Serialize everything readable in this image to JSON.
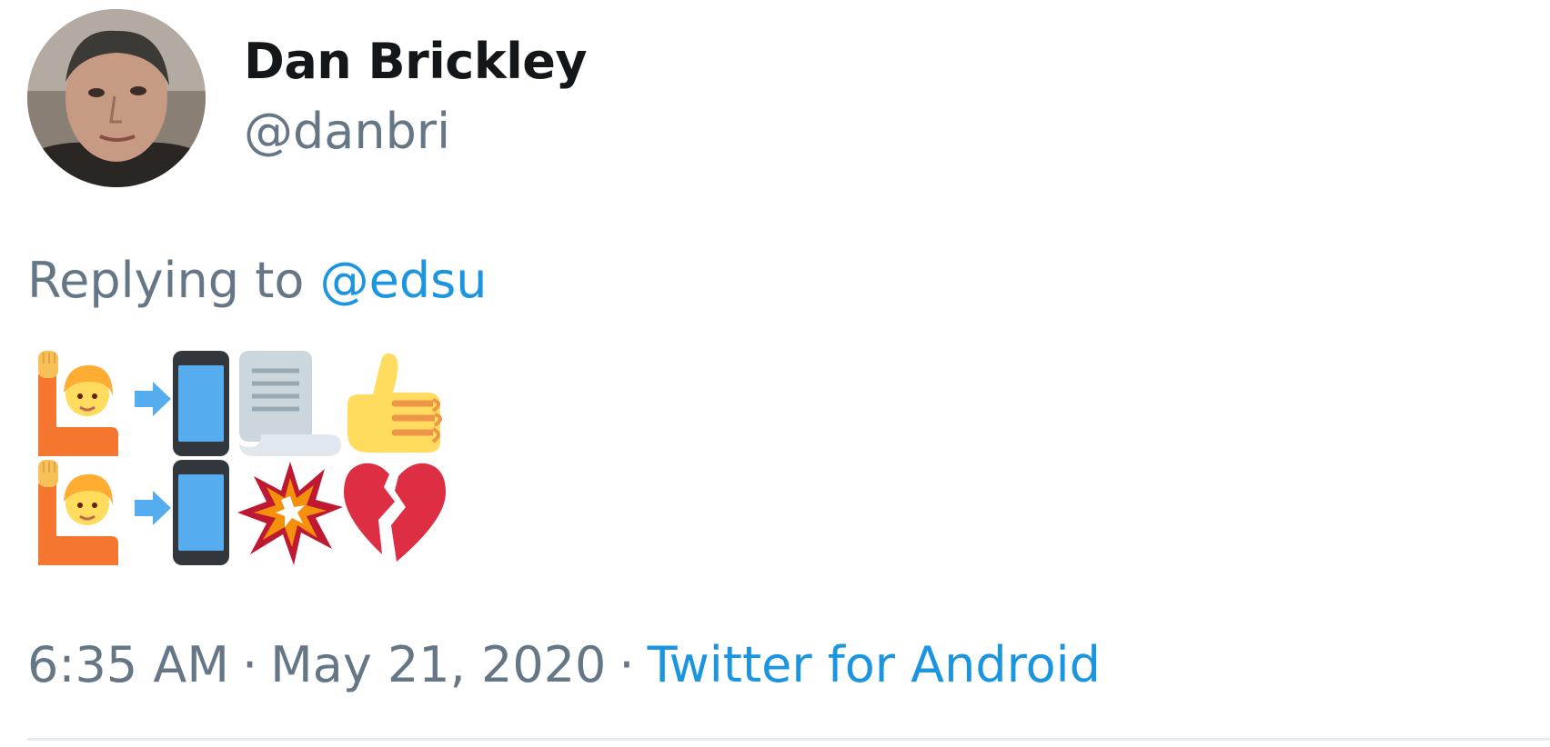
{
  "tweet": {
    "author": {
      "display_name": "Dan Brickley",
      "handle": "@danbri",
      "avatar_icon": "profile-photo"
    },
    "reply_context": {
      "prefix": "Replying to",
      "mention": "@edsu"
    },
    "emoji_lines": [
      [
        "person-raising-hand",
        "arrow-into-phone",
        "page-scroll",
        "thumbs-up"
      ],
      [
        "person-raising-hand",
        "arrow-into-phone",
        "explosion",
        "broken-heart"
      ]
    ],
    "meta": {
      "time": "6:35 AM",
      "separator": "·",
      "date": "May 21, 2020",
      "source": "Twitter for Android"
    },
    "colors": {
      "name": "#14171a",
      "secondary": "#657786",
      "link": "#1b95e0",
      "divider": "#e6ecf0"
    }
  }
}
